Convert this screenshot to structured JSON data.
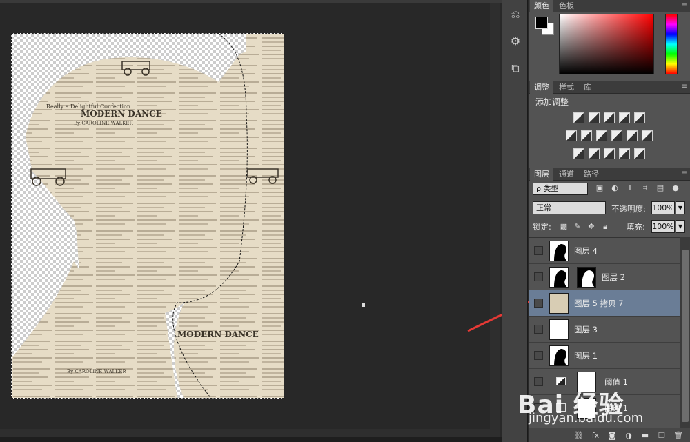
{
  "panels": {
    "color_tabs": [
      "颜色",
      "色板"
    ],
    "adjust_tabs": [
      "调整",
      "样式",
      "库"
    ],
    "adjust_title": "添加调整",
    "layer_tabs": [
      "图层",
      "通道",
      "路径"
    ]
  },
  "layers_panel": {
    "kind_filter": "ρ 类型",
    "blend_mode": "正常",
    "opacity_label": "不透明度:",
    "opacity_value": "100%",
    "lock_label": "锁定:",
    "fill_label": "填充:",
    "fill_value": "100%",
    "layers": [
      {
        "name": "图层 4",
        "selected": false
      },
      {
        "name": "图层 2",
        "selected": false
      },
      {
        "name": "图层 5 拷贝 7",
        "selected": true
      },
      {
        "name": "图层 3",
        "selected": false
      },
      {
        "name": "图层 1",
        "selected": false
      },
      {
        "name": "阈值 1",
        "selected": false
      },
      {
        "name": "曲线 1",
        "selected": false
      }
    ]
  },
  "canvas": {
    "newspaper_headline": "MODERN DANCE",
    "newspaper_byline": "By CAROLINE WALKER",
    "newspaper_line": "Really a Delightful Confection"
  },
  "watermark": {
    "logo": "Bai 经验",
    "url": "jingyan.baidu.com"
  },
  "colors": {
    "accent_selected": "#6a7d96",
    "arrow": "#e53935"
  }
}
